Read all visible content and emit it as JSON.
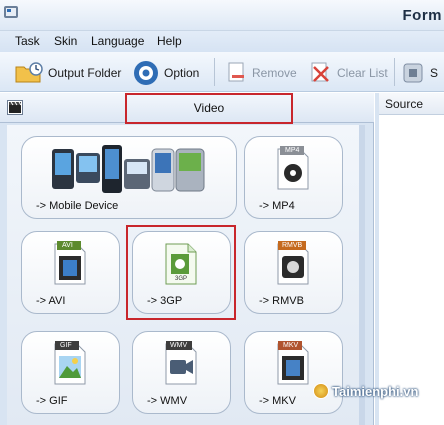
{
  "window": {
    "title": "Form"
  },
  "menu": {
    "items": [
      "Task",
      "Skin",
      "Language",
      "Help"
    ]
  },
  "toolbar": {
    "output_folder": "Output Folder",
    "option": "Option",
    "remove": "Remove",
    "clear_list": "Clear List",
    "cut_label": "S"
  },
  "panel": {
    "title": "Video"
  },
  "source_panel": {
    "header": "Source"
  },
  "tiles": [
    {
      "label": "-> Mobile Device",
      "badge": ""
    },
    {
      "label": "-> MP4",
      "badge": "MP4"
    },
    {
      "label": "-> AVI",
      "badge": "AVI"
    },
    {
      "label": "-> 3GP",
      "badge": "3GP"
    },
    {
      "label": "-> RMVB",
      "badge": "RMVB"
    },
    {
      "label": "-> GIF",
      "badge": "GIF"
    },
    {
      "label": "-> WMV",
      "badge": "WMV"
    },
    {
      "label": "-> MKV",
      "badge": "MKV"
    }
  ],
  "colors": {
    "highlight": "#c8262c",
    "accent": "#2f6db5"
  },
  "watermark": "Taimienphi.vn"
}
